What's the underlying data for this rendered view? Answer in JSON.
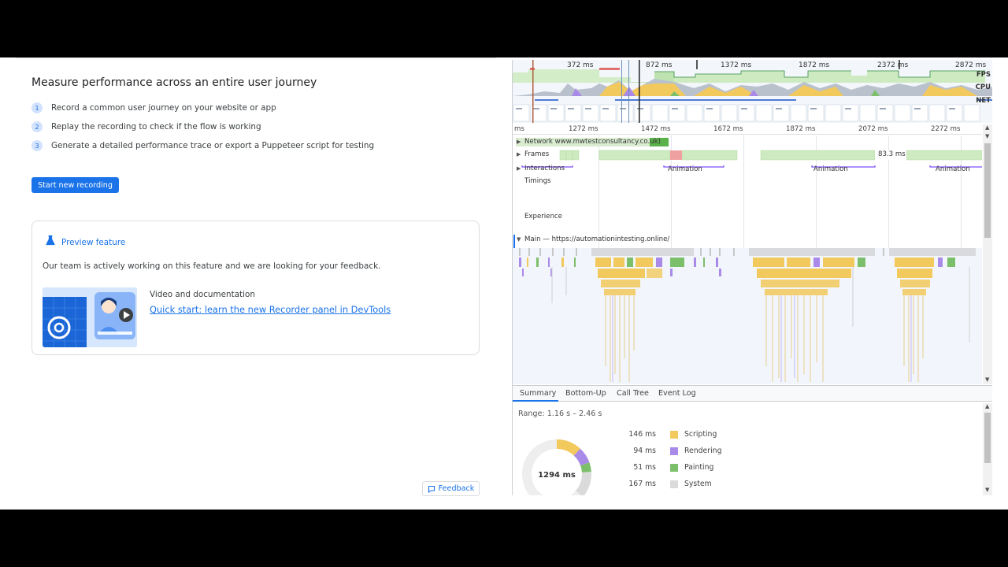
{
  "recorder": {
    "title": "Measure performance across an entire user journey",
    "steps": [
      {
        "num": "1",
        "text": "Record a common user journey on your website or app"
      },
      {
        "num": "2",
        "text": "Replay the recording to check if the flow is working"
      },
      {
        "num": "3",
        "text": "Generate a detailed performance trace or export a Puppeteer script for testing"
      }
    ],
    "start_button": "Start new recording",
    "preview": {
      "label": "Preview feature",
      "description": "Our team is actively working on this feature and we are looking for your feedback.",
      "video_label": "Video and documentation",
      "link_text": "Quick start: learn the new Recorder panel in DevTools"
    },
    "feedback_button": "Feedback"
  },
  "performance": {
    "overview_ticks": [
      "372 ms",
      "872 ms",
      "1372 ms",
      "1872 ms",
      "2372 ms",
      "2872 ms"
    ],
    "overview_labels": [
      "FPS",
      "CPU",
      "NET"
    ],
    "ruler_ticks": [
      "ms",
      "1272 ms",
      "1472 ms",
      "1672 ms",
      "1872 ms",
      "2072 ms",
      "2272 ms"
    ],
    "tracks": {
      "network": "Network www.mwtestconsultancy.co.uk)",
      "frames": "Frames",
      "frames_value": "83.3 ms",
      "interactions": "Interactions",
      "animation": "Animation",
      "timings": "Timings",
      "experience": "Experience",
      "main": "Main — https://automationintesting.online/"
    },
    "bottom_tabs": [
      "Summary",
      "Bottom-Up",
      "Call Tree",
      "Event Log"
    ],
    "range": "Range: 1.16 s – 2.46 s",
    "total": "1294 ms",
    "summary": [
      {
        "ms": "146 ms",
        "name": "Scripting",
        "color": "#f2c95c"
      },
      {
        "ms": "94 ms",
        "name": "Rendering",
        "color": "#a98ae8"
      },
      {
        "ms": "51 ms",
        "name": "Painting",
        "color": "#7cbf6b"
      },
      {
        "ms": "167 ms",
        "name": "System",
        "color": "#dadada"
      }
    ],
    "colors": {
      "accent": "#1a73e8",
      "scripting": "#f2c95c",
      "rendering": "#a98ae8",
      "painting": "#7cbf6b",
      "idle": "#e8e8e8"
    }
  }
}
